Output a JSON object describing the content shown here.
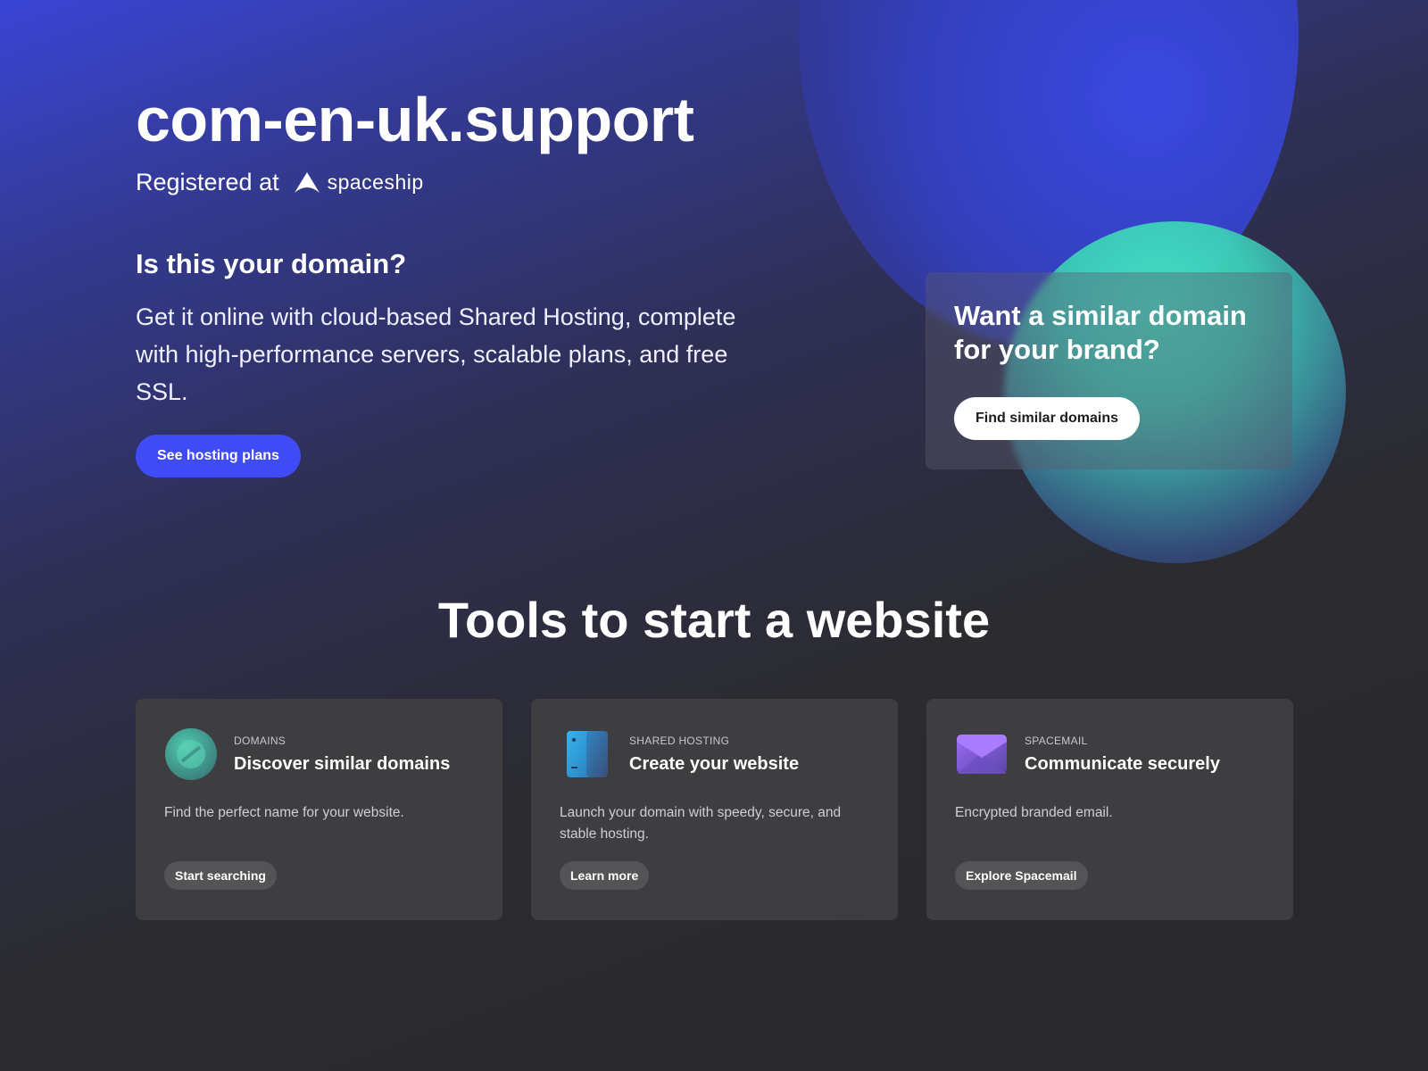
{
  "hero": {
    "domain": "com-en-uk.support",
    "registered_label": "Registered at",
    "brand_name": "spaceship",
    "question": "Is this your domain?",
    "description": "Get it online with cloud-based Shared Hosting, complete with high-performance servers, scalable plans, and free SSL.",
    "cta_label": "See hosting plans"
  },
  "similar": {
    "title": "Want a similar domain for your brand?",
    "button_label": "Find similar domains"
  },
  "tools": {
    "title": "Tools to start a website",
    "cards": [
      {
        "icon": "domains-icon",
        "category": "DOMAINS",
        "title": "Discover similar domains",
        "description": "Find the perfect name for your website.",
        "button": "Start searching"
      },
      {
        "icon": "server-icon",
        "category": "SHARED HOSTING",
        "title": "Create your website",
        "description": "Launch your domain with speedy, secure, and stable hosting.",
        "button": "Learn more"
      },
      {
        "icon": "mail-icon",
        "category": "SPACEMAIL",
        "title": "Communicate securely",
        "description": "Encrypted branded email.",
        "button": "Explore Spacemail"
      }
    ]
  },
  "colors": {
    "accent": "#3f4cf5",
    "teal": "#45e6c4",
    "background": "#2a2a2c",
    "card": "#3e3e41"
  }
}
